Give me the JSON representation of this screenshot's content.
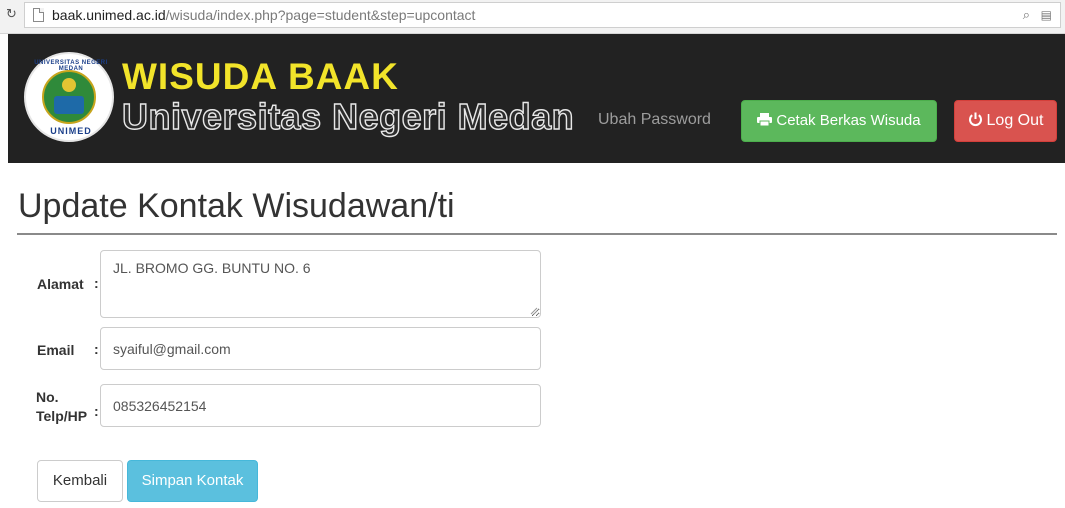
{
  "browser": {
    "url_host": "baak.unimed.ac.id",
    "url_path": "/wisuda/index.php?page=student&step=upcontact"
  },
  "header": {
    "logo_ring_top": "UNIVERSITAS NEGERI MEDAN",
    "logo_ring_bottom": "UNIMED",
    "brand_title": "WISUDA BAAK",
    "brand_subtitle": "Universitas Negeri Medan",
    "nav_change_password": "Ubah Password",
    "print_button": "Cetak Berkas Wisuda",
    "logout_button": "Log Out",
    "colors": {
      "bar": "#222222",
      "title": "#f2e42a",
      "print": "#5cb85c",
      "logout": "#d9534f"
    }
  },
  "form": {
    "title": "Update Kontak Wisudawan/ti",
    "address_label": "Alamat",
    "address_value": "JL. BROMO GG. BUNTU NO. 6",
    "email_label": "Email",
    "email_value": "syaiful@gmail.com",
    "phone_label_line1": "No.",
    "phone_label_line2": "Telp/HP",
    "phone_value": "085326452154",
    "colon": ":",
    "back_button": "Kembali",
    "save_button": "Simpan Kontak",
    "colors": {
      "save": "#5bc0de"
    }
  },
  "icons": {
    "reload": "reload-icon",
    "page": "page-icon",
    "zoom": "zoom-icon",
    "translate": "translate-icon",
    "printer": "printer-icon",
    "power": "power-icon"
  }
}
